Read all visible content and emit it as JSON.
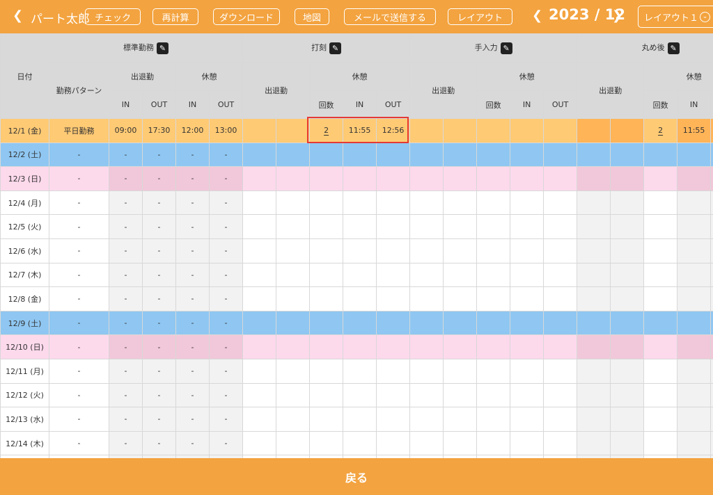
{
  "header": {
    "user_name": "パート太郎",
    "buttons": {
      "check": "チェック",
      "recalc": "再計算",
      "download": "ダウンロード",
      "map": "地図",
      "email": "メールで送信する",
      "layout": "レイアウト"
    },
    "month": "2023 / 12",
    "layout_select": "レイアウト１",
    "icons": {
      "back": "chevron-left-icon",
      "prev": "chevron-left-icon",
      "next": "chevron-right-icon",
      "dropdown": "chevron-down-circle-icon"
    }
  },
  "table": {
    "date_header": "日付",
    "pattern_header": "勤務パターン",
    "groups": {
      "standard": "標準勤務",
      "stamp": "打刻",
      "manual": "手入力",
      "rounded": "丸め後"
    },
    "sub": {
      "attendance": "出退勤",
      "break": "休憩"
    },
    "cols": {
      "in": "IN",
      "out": "OUT",
      "count": "回数"
    },
    "rows": [
      {
        "date": "12/1 (金)",
        "pattern": "平日勤務",
        "s_in": "09:00",
        "s_out": "17:30",
        "s_bin": "12:00",
        "s_bout": "13:00",
        "p_count": "2",
        "p_bin": "11:55",
        "p_bout": "12:56",
        "r_count": "2",
        "r_bin": "11:55"
      },
      {
        "date": "12/2 (土)",
        "pattern": "-",
        "s_in": "-",
        "s_out": "-",
        "s_bin": "-",
        "s_bout": "-"
      },
      {
        "date": "12/3 (日)",
        "pattern": "-",
        "s_in": "-",
        "s_out": "-",
        "s_bin": "-",
        "s_bout": "-"
      },
      {
        "date": "12/4 (月)",
        "pattern": "-",
        "s_in": "-",
        "s_out": "-",
        "s_bin": "-",
        "s_bout": "-"
      },
      {
        "date": "12/5 (火)",
        "pattern": "-",
        "s_in": "-",
        "s_out": "-",
        "s_bin": "-",
        "s_bout": "-"
      },
      {
        "date": "12/6 (水)",
        "pattern": "-",
        "s_in": "-",
        "s_out": "-",
        "s_bin": "-",
        "s_bout": "-"
      },
      {
        "date": "12/7 (木)",
        "pattern": "-",
        "s_in": "-",
        "s_out": "-",
        "s_bin": "-",
        "s_bout": "-"
      },
      {
        "date": "12/8 (金)",
        "pattern": "-",
        "s_in": "-",
        "s_out": "-",
        "s_bin": "-",
        "s_bout": "-"
      },
      {
        "date": "12/9 (土)",
        "pattern": "-",
        "s_in": "-",
        "s_out": "-",
        "s_bin": "-",
        "s_bout": "-"
      },
      {
        "date": "12/10 (日)",
        "pattern": "-",
        "s_in": "-",
        "s_out": "-",
        "s_bin": "-",
        "s_bout": "-"
      },
      {
        "date": "12/11 (月)",
        "pattern": "-",
        "s_in": "-",
        "s_out": "-",
        "s_bin": "-",
        "s_bout": "-"
      },
      {
        "date": "12/12 (火)",
        "pattern": "-",
        "s_in": "-",
        "s_out": "-",
        "s_bin": "-",
        "s_bout": "-"
      },
      {
        "date": "12/13 (水)",
        "pattern": "-",
        "s_in": "-",
        "s_out": "-",
        "s_bin": "-",
        "s_bout": "-"
      },
      {
        "date": "12/14 (木)",
        "pattern": "-",
        "s_in": "-",
        "s_out": "-",
        "s_bin": "-",
        "s_bout": "-"
      },
      {
        "date": "",
        "pattern": "",
        "s_in": "",
        "s_out": "",
        "s_bin": "",
        "s_bout": ""
      }
    ]
  },
  "footer": {
    "back_label": "戻る"
  },
  "colors": {
    "accent": "#F3A33F",
    "saturday": "#8FC7F2",
    "sunday": "#FDD9EC",
    "selected": "#FFCA74",
    "highlight": "#E53935"
  }
}
